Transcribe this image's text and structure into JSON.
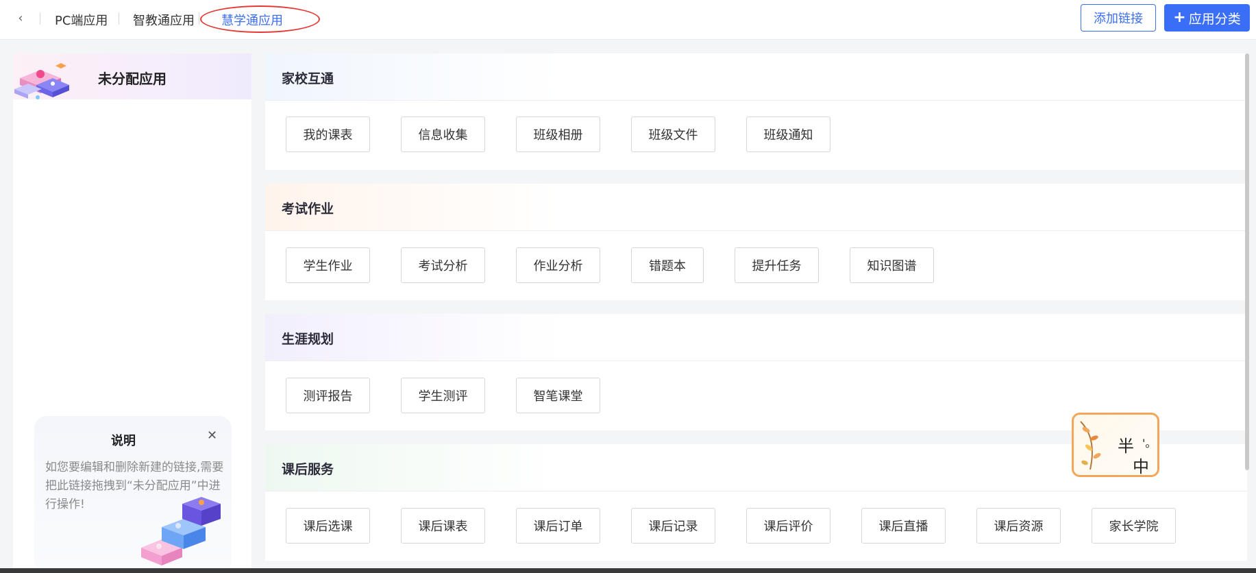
{
  "header": {
    "tabs": [
      {
        "label": "PC端应用"
      },
      {
        "label": "智教通应用"
      },
      {
        "label": "慧学通应用"
      }
    ],
    "add_link_label": "添加链接",
    "add_category_label": "应用分类",
    "active_tab": "慧学通应用"
  },
  "left_panel": {
    "title": "未分配应用",
    "info": {
      "title": "说明",
      "text": "如您要编辑和删除新建的链接,需要把此链接拖拽到“未分配应用”中进行操作!"
    }
  },
  "sections": [
    {
      "title": "家校互通",
      "apps": [
        "我的课表",
        "信息收集",
        "班级相册",
        "班级文件",
        "班级通知"
      ]
    },
    {
      "title": "考试作业",
      "apps": [
        "学生作业",
        "考试分析",
        "作业分析",
        "错题本",
        "提升任务",
        "知识图谱"
      ]
    },
    {
      "title": "生涯规划",
      "apps": [
        "测评报告",
        "学生测评",
        "智笔课堂"
      ]
    },
    {
      "title": "课后服务",
      "apps": [
        "课后选课",
        "课后课表",
        "课后订单",
        "课后记录",
        "课后评价",
        "课后直播",
        "课后资源",
        "家长学院"
      ]
    }
  ],
  "float_widget": {
    "text_top": "半",
    "text_bottom": "中"
  },
  "colors": {
    "accent": "#3b6ef6",
    "highlight_ring": "#e53935"
  }
}
